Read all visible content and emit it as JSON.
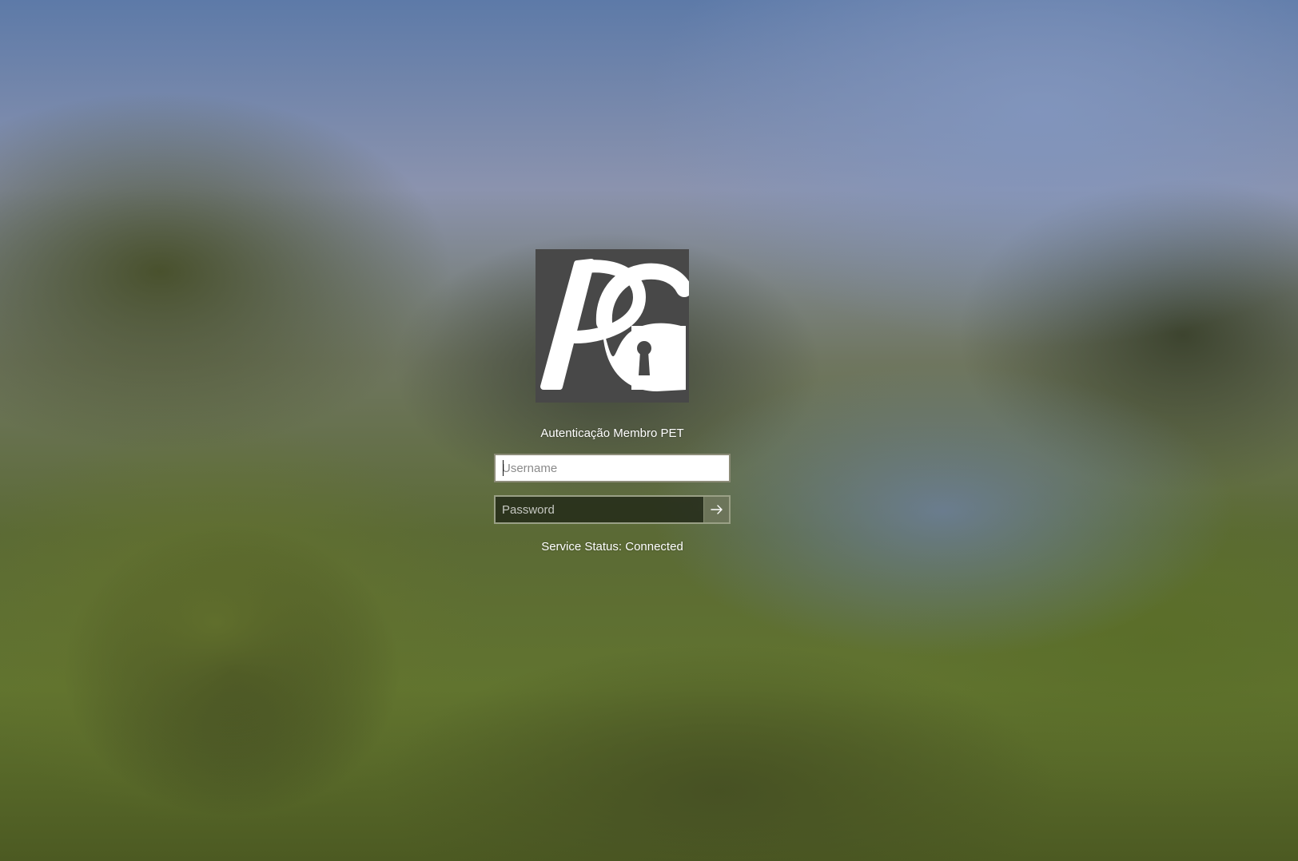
{
  "login": {
    "title": "Autenticação Membro PET",
    "username_placeholder": "Username",
    "password_placeholder": "Password",
    "status_text": "Service Status: Connected"
  },
  "icons": {
    "logo": "pg-padlock-logo-icon",
    "submit": "arrow-right-icon"
  },
  "colors": {
    "logo_tile_bg": "#484848",
    "text": "#ffffff"
  }
}
